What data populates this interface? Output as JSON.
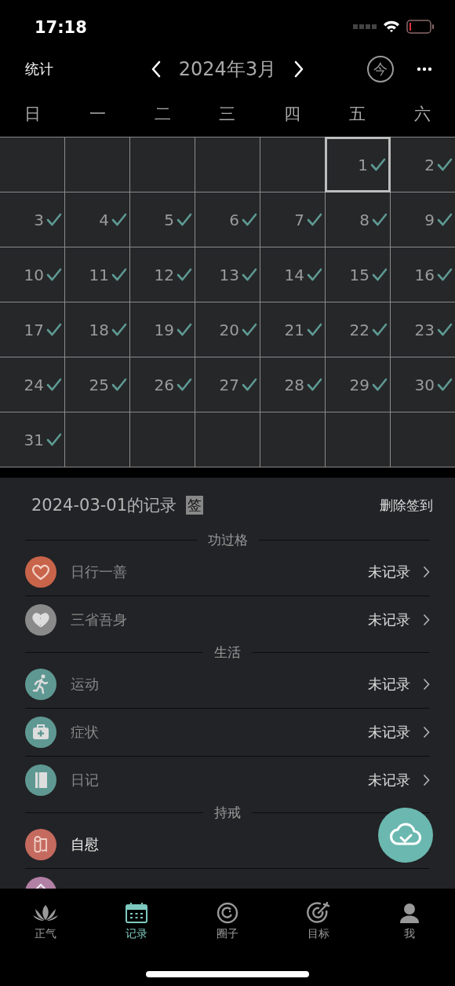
{
  "status_bar": {
    "time": "17:18"
  },
  "nav": {
    "left": "统计",
    "title": "2024年3月",
    "today": "今"
  },
  "weekdays": [
    "日",
    "一",
    "二",
    "三",
    "四",
    "五",
    "六"
  ],
  "calendar": [
    {
      "kind": "blank"
    },
    {
      "kind": "blank"
    },
    {
      "kind": "blank"
    },
    {
      "kind": "blank"
    },
    {
      "kind": "blank"
    },
    {
      "kind": "day",
      "day": "1",
      "checked": true,
      "selected": true
    },
    {
      "kind": "day",
      "day": "2",
      "checked": true,
      "selected": false
    },
    {
      "kind": "day",
      "day": "3",
      "checked": true,
      "selected": false
    },
    {
      "kind": "day",
      "day": "4",
      "checked": true,
      "selected": false
    },
    {
      "kind": "day",
      "day": "5",
      "checked": true,
      "selected": false
    },
    {
      "kind": "day",
      "day": "6",
      "checked": true,
      "selected": false
    },
    {
      "kind": "day",
      "day": "7",
      "checked": true,
      "selected": false
    },
    {
      "kind": "day",
      "day": "8",
      "checked": true,
      "selected": false
    },
    {
      "kind": "day",
      "day": "9",
      "checked": true,
      "selected": false
    },
    {
      "kind": "day",
      "day": "10",
      "checked": true,
      "selected": false
    },
    {
      "kind": "day",
      "day": "11",
      "checked": true,
      "selected": false
    },
    {
      "kind": "day",
      "day": "12",
      "checked": true,
      "selected": false
    },
    {
      "kind": "day",
      "day": "13",
      "checked": true,
      "selected": false
    },
    {
      "kind": "day",
      "day": "14",
      "checked": true,
      "selected": false
    },
    {
      "kind": "day",
      "day": "15",
      "checked": true,
      "selected": false
    },
    {
      "kind": "day",
      "day": "16",
      "checked": true,
      "selected": false
    },
    {
      "kind": "day",
      "day": "17",
      "checked": true,
      "selected": false
    },
    {
      "kind": "day",
      "day": "18",
      "checked": true,
      "selected": false
    },
    {
      "kind": "day",
      "day": "19",
      "checked": true,
      "selected": false
    },
    {
      "kind": "day",
      "day": "20",
      "checked": true,
      "selected": false
    },
    {
      "kind": "day",
      "day": "21",
      "checked": true,
      "selected": false
    },
    {
      "kind": "day",
      "day": "22",
      "checked": true,
      "selected": false
    },
    {
      "kind": "day",
      "day": "23",
      "checked": true,
      "selected": false
    },
    {
      "kind": "day",
      "day": "24",
      "checked": true,
      "selected": false
    },
    {
      "kind": "day",
      "day": "25",
      "checked": true,
      "selected": false
    },
    {
      "kind": "day",
      "day": "26",
      "checked": true,
      "selected": false
    },
    {
      "kind": "day",
      "day": "27",
      "checked": true,
      "selected": false
    },
    {
      "kind": "day",
      "day": "28",
      "checked": true,
      "selected": false
    },
    {
      "kind": "day",
      "day": "29",
      "checked": true,
      "selected": false
    },
    {
      "kind": "day",
      "day": "30",
      "checked": true,
      "selected": false
    },
    {
      "kind": "day",
      "day": "31",
      "checked": true,
      "selected": false
    },
    {
      "kind": "blank"
    },
    {
      "kind": "blank"
    },
    {
      "kind": "blank"
    },
    {
      "kind": "blank"
    },
    {
      "kind": "blank"
    },
    {
      "kind": "blank"
    }
  ],
  "record": {
    "title": "2024-03-01的记录",
    "badge": "签",
    "action": "删除签到",
    "sections": [
      {
        "title": "功过格",
        "items": [
          {
            "kind": "heart",
            "color": "#c8644a",
            "label": "日行一善",
            "status": "未记录",
            "emphasized": false
          },
          {
            "kind": "broken",
            "color": "#8a8a8a",
            "label": "三省吾身",
            "status": "未记录",
            "emphasized": false
          }
        ]
      },
      {
        "title": "生活",
        "items": [
          {
            "kind": "runner",
            "color": "#5f9893",
            "label": "运动",
            "status": "未记录",
            "emphasized": false
          },
          {
            "kind": "medkit",
            "color": "#5f9893",
            "label": "症状",
            "status": "未记录",
            "emphasized": false
          },
          {
            "kind": "notebook",
            "color": "#5f9893",
            "label": "日记",
            "status": "未记录",
            "emphasized": false
          }
        ]
      },
      {
        "title": "持戒",
        "items": [
          {
            "kind": "roll",
            "color": "#c56a5f",
            "label": "自慰",
            "emphasized": true
          },
          {
            "kind": "other",
            "color": "#b27fa5"
          }
        ]
      }
    ]
  },
  "tabbar": [
    {
      "kind": "lotus",
      "label": "正气",
      "selected": false
    },
    {
      "kind": "calendar",
      "label": "记录",
      "selected": true
    },
    {
      "kind": "ring",
      "label": "圈子",
      "selected": false
    },
    {
      "kind": "target",
      "label": "目标",
      "selected": false
    },
    {
      "kind": "person",
      "label": "我",
      "selected": false
    }
  ]
}
